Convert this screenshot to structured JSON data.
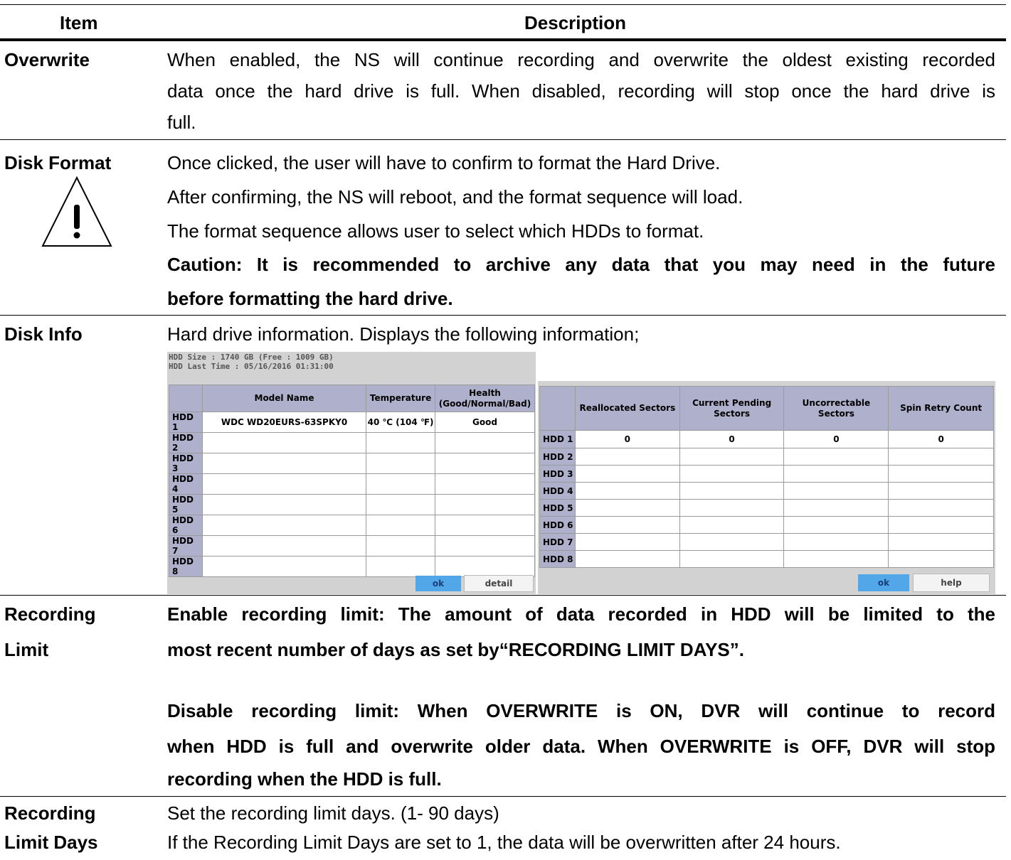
{
  "header": {
    "item": "Item",
    "description": "Description"
  },
  "overwrite": {
    "label": "Overwrite",
    "line1": "When enabled, the NS will continue recording and overwrite the oldest existing recorded",
    "line2": "data once the hard drive is full. When disabled, recording will stop once the hard drive is",
    "line3": "full."
  },
  "disk_format": {
    "label": "Disk Format",
    "line1": "Once clicked, the user will have to confirm to format the Hard Drive.",
    "line2": "After confirming, the NS will reboot, and the format sequence will load.",
    "line3": "The format sequence allows user to select which HDDs to format.",
    "caution1": "Caution: It is recommended to archive any data that you may need in the future",
    "caution2": "before formatting the hard drive.",
    "icon": "warning-triangle-icon"
  },
  "disk_info": {
    "label": "Disk Info",
    "text": "Hard drive information. Displays the following information;",
    "hdd_size": "HDD Size : 1740 GB (Free : 1009 GB)",
    "hdd_last_time": "HDD Last Time : 05/16/2016 01:31:00",
    "left_table": {
      "headers": [
        "",
        "Model Name",
        "Temperature",
        "Health (Good/Normal/Bad)"
      ],
      "rows": [
        {
          "hdd": "HDD 1",
          "model": "WDC WD20EURS-63SPKY0",
          "temp": "40 ℃ (104 ℉)",
          "health": "Good"
        },
        {
          "hdd": "HDD 2",
          "model": "",
          "temp": "",
          "health": ""
        },
        {
          "hdd": "HDD 3",
          "model": "",
          "temp": "",
          "health": ""
        },
        {
          "hdd": "HDD 4",
          "model": "",
          "temp": "",
          "health": ""
        },
        {
          "hdd": "HDD 5",
          "model": "",
          "temp": "",
          "health": ""
        },
        {
          "hdd": "HDD 6",
          "model": "",
          "temp": "",
          "health": ""
        },
        {
          "hdd": "HDD 7",
          "model": "",
          "temp": "",
          "health": ""
        },
        {
          "hdd": "HDD 8",
          "model": "",
          "temp": "",
          "health": ""
        }
      ],
      "ok": "ok",
      "detail": "detail"
    },
    "right_table": {
      "headers": [
        "",
        "Reallocated Sectors",
        "Current Pending Sectors",
        "Uncorrectable Sectors",
        "Spin Retry Count"
      ],
      "rows": [
        {
          "hdd": "HDD 1",
          "a": "0",
          "b": "0",
          "c": "0",
          "d": "0"
        },
        {
          "hdd": "HDD 2",
          "a": "",
          "b": "",
          "c": "",
          "d": ""
        },
        {
          "hdd": "HDD 3",
          "a": "",
          "b": "",
          "c": "",
          "d": ""
        },
        {
          "hdd": "HDD 4",
          "a": "",
          "b": "",
          "c": "",
          "d": ""
        },
        {
          "hdd": "HDD 5",
          "a": "",
          "b": "",
          "c": "",
          "d": ""
        },
        {
          "hdd": "HDD 6",
          "a": "",
          "b": "",
          "c": "",
          "d": ""
        },
        {
          "hdd": "HDD 7",
          "a": "",
          "b": "",
          "c": "",
          "d": ""
        },
        {
          "hdd": "HDD 8",
          "a": "",
          "b": "",
          "c": "",
          "d": ""
        }
      ],
      "ok": "ok",
      "help": "help"
    }
  },
  "recording_limit": {
    "label1": "Recording",
    "label2": "Limit",
    "en1": "Enable recording limit: The amount of data recorded in HDD will be limited to the",
    "en2": "most recent number of days as set by“RECORDING LIMIT DAYS”.",
    "dis1": "Disable recording limit: When OVERWRITE is ON, DVR will continue to record",
    "dis2": "when HDD is full and overwrite older data. When OVERWRITE is OFF, DVR will stop",
    "dis3": "recording when the HDD is full."
  },
  "recording_limit_days": {
    "label1": "Recording",
    "label2": "Limit Days",
    "line1": "Set the recording limit days. (1- 90 days)",
    "line2": "If the Recording Limit Days are set to 1, the data will be overwritten after 24 hours."
  }
}
